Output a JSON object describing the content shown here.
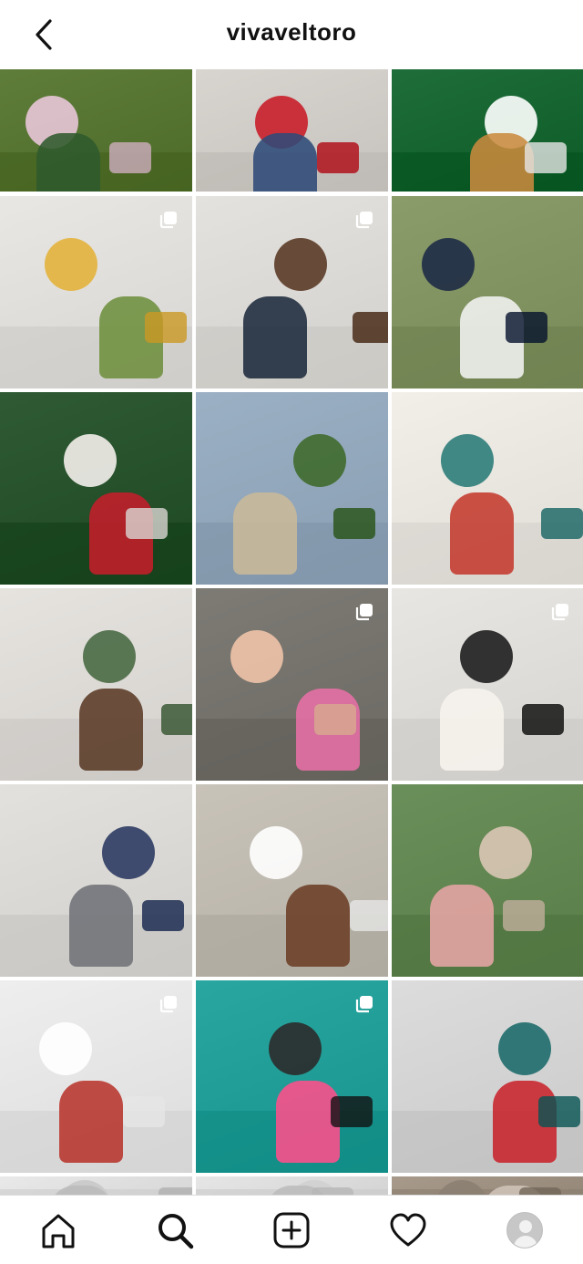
{
  "header": {
    "title": "vivaveltoro",
    "back_icon": "chevron-left-icon"
  },
  "posts": [
    {
      "id": "post-1",
      "desc": "food-wine-festival",
      "multi": false,
      "colors": {
        "bg": "#5f7d3a",
        "accent": "#e8c7d8",
        "accent2": "#2f5a2c"
      }
    },
    {
      "id": "post-2",
      "desc": "woman-sitting-floor",
      "multi": false,
      "colors": {
        "bg": "#d8d4cf",
        "accent": "#c81f2a",
        "accent2": "#2e4a78"
      }
    },
    {
      "id": "post-3",
      "desc": "game-day-spread",
      "multi": false,
      "colors": {
        "bg": "#1f6e3a",
        "accent": "#ffffff",
        "accent2": "#c98a3e"
      }
    },
    {
      "id": "post-4",
      "desc": "kitchen-ingredients",
      "multi": true,
      "colors": {
        "bg": "#e9e7e3",
        "accent": "#e3b23c",
        "accent2": "#6e8f3e"
      }
    },
    {
      "id": "post-5",
      "desc": "woman-cooking-kitchen",
      "multi": true,
      "colors": {
        "bg": "#e4e2de",
        "accent": "#5a3a26",
        "accent2": "#1d2a3c"
      }
    },
    {
      "id": "post-6",
      "desc": "family-portrait-outdoors",
      "multi": false,
      "colors": {
        "bg": "#8a9c6a",
        "accent": "#1e2b46",
        "accent2": "#f2f2f2"
      }
    },
    {
      "id": "post-7",
      "desc": "christmas-gift-card",
      "multi": false,
      "colors": {
        "bg": "#2f5a34",
        "accent": "#f4f0ec",
        "accent2": "#c41e2a"
      }
    },
    {
      "id": "post-8",
      "desc": "busch-gardens-sculpture",
      "multi": false,
      "colors": {
        "bg": "#9bb0c4",
        "accent": "#3f6a2c",
        "accent2": "#c9b99a"
      }
    },
    {
      "id": "post-9",
      "desc": "ornament-circles",
      "multi": false,
      "colors": {
        "bg": "#f2eee8",
        "accent": "#2e7d7a",
        "accent2": "#c43a2e"
      }
    },
    {
      "id": "post-10",
      "desc": "woman-kitchen-checklist",
      "multi": false,
      "colors": {
        "bg": "#e6e3df",
        "accent": "#4a6a45",
        "accent2": "#5a3a26"
      }
    },
    {
      "id": "post-11",
      "desc": "girl-with-dolls",
      "multi": true,
      "colors": {
        "bg": "#7d7b74",
        "accent": "#f0c3a8",
        "accent2": "#e76fa6"
      }
    },
    {
      "id": "post-12",
      "desc": "woman-kitchen-papers",
      "multi": true,
      "colors": {
        "bg": "#e8e6e2",
        "accent": "#1e1e1e",
        "accent2": "#f7f4ee"
      }
    },
    {
      "id": "post-13",
      "desc": "woman-kitchen-island",
      "multi": false,
      "colors": {
        "bg": "#e3e1dd",
        "accent": "#2c3b63",
        "accent2": "#6f7277"
      }
    },
    {
      "id": "post-14",
      "desc": "woman-white-tee-table",
      "multi": false,
      "colors": {
        "bg": "#c8c3b9",
        "accent": "#ffffff",
        "accent2": "#6b3d25"
      }
    },
    {
      "id": "post-15",
      "desc": "kids-lying-patio",
      "multi": false,
      "colors": {
        "bg": "#6b8f5a",
        "accent": "#d9c7b5",
        "accent2": "#e7a5a5"
      }
    },
    {
      "id": "post-16",
      "desc": "woman-holding-book",
      "multi": true,
      "colors": {
        "bg": "#eeeeee",
        "accent": "#ffffff",
        "accent2": "#b8352c"
      }
    },
    {
      "id": "post-17",
      "desc": "woman-gym",
      "multi": true,
      "colors": {
        "bg": "#2aa6a0",
        "accent": "#2b2b2b",
        "accent2": "#ff4f8b"
      }
    },
    {
      "id": "post-18",
      "desc": "woman-teal-top-kitchen",
      "multi": false,
      "colors": {
        "bg": "#dcdcdc",
        "accent": "#1f6b6b",
        "accent2": "#c8232b"
      }
    },
    {
      "id": "post-19",
      "desc": "partial-row",
      "multi": false,
      "colors": {
        "bg": "#e9e9e9",
        "accent": "#c9c9c9",
        "accent2": "#bbbbbb"
      }
    },
    {
      "id": "post-20",
      "desc": "partial-row",
      "multi": false,
      "colors": {
        "bg": "#e6e6e6",
        "accent": "#d0d0d0",
        "accent2": "#bcbcbc"
      }
    },
    {
      "id": "post-21",
      "desc": "partial-row",
      "multi": false,
      "colors": {
        "bg": "#a79a8b",
        "accent": "#8b7f72",
        "accent2": "#cfc4b8"
      }
    }
  ],
  "nav": {
    "items": [
      {
        "name": "home-icon"
      },
      {
        "name": "search-icon"
      },
      {
        "name": "add-post-icon"
      },
      {
        "name": "heart-icon"
      },
      {
        "name": "profile-avatar"
      }
    ]
  }
}
